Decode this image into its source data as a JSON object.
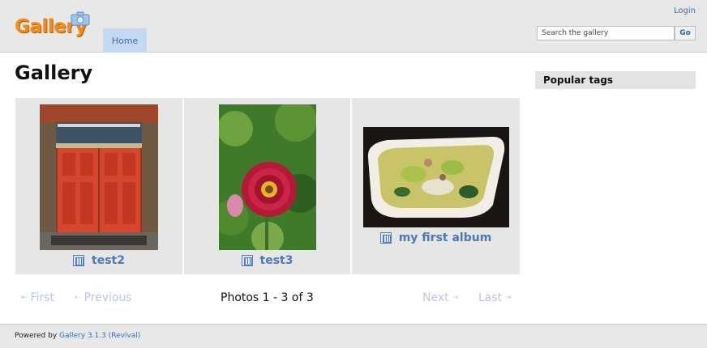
{
  "header": {
    "logo_text": "Gallery",
    "login_label": "Login",
    "tab_home": "Home",
    "search_placeholder": "Search the gallery",
    "go_label": "Go"
  },
  "main": {
    "title": "Gallery",
    "items": [
      {
        "title": "test2",
        "icon": "album-icon"
      },
      {
        "title": "test3",
        "icon": "album-icon"
      },
      {
        "title": "my first album",
        "icon": "album-icon"
      }
    ],
    "pager": {
      "first": "First",
      "previous": "Previous",
      "info": "Photos 1 - 3 of 3",
      "next": "Next",
      "last": "Last"
    }
  },
  "sidebar": {
    "popular_tags_title": "Popular tags"
  },
  "footer": {
    "prefix": "Powered by ",
    "link": "Gallery 3.1.3 (Revival)"
  },
  "colors": {
    "link": "#3a6fb0",
    "tab_active": "#c5d8f2",
    "logo_orange": "#f28a1e"
  }
}
